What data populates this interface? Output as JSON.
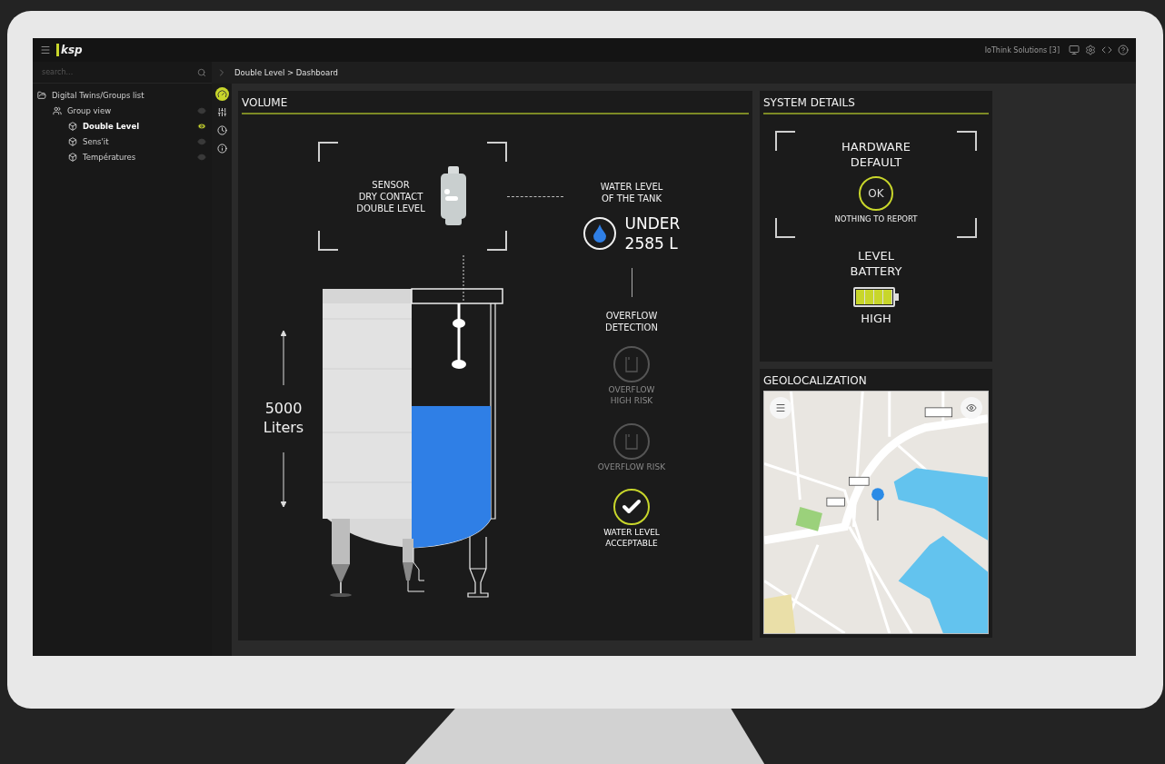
{
  "topbar": {
    "logo": "ksp",
    "account": "IoThink Solutions [3]"
  },
  "sidebar": {
    "search": {
      "placeholder": "search..."
    },
    "tree": [
      {
        "label": "Digital Twins/Groups list",
        "kind": "folder",
        "selected": false,
        "children": [
          {
            "label": "Group view",
            "kind": "group",
            "selected": false,
            "children": [
              {
                "label": "Double Level",
                "kind": "device",
                "selected": true
              },
              {
                "label": "Sens'it",
                "kind": "device",
                "selected": false
              },
              {
                "label": "Températures",
                "kind": "device",
                "selected": false
              }
            ]
          }
        ]
      }
    ]
  },
  "rail": [
    {
      "kind": "dashboard",
      "selected": true
    },
    {
      "kind": "settings",
      "selected": false
    },
    {
      "kind": "history",
      "selected": false
    },
    {
      "kind": "info",
      "selected": false
    }
  ],
  "breadcrumb": "Double Level > Dashboard",
  "volume": {
    "title": "VOLUME",
    "sensor": "SENSOR\nDRY CONTACT\nDOUBLE LEVEL",
    "capacity": "5000\nLiters",
    "tank": {
      "level": 0.58
    },
    "water_level": {
      "title": "WATER LEVEL\nOF THE TANK",
      "reading": "UNDER\n2585 L"
    },
    "overflow": {
      "title": "OVERFLOW\nDETECTION",
      "indicators": [
        {
          "label": "OVERFLOW\nHIGH RISK",
          "kind": "overflow",
          "active": false
        },
        {
          "label": "OVERFLOW RISK",
          "kind": "overflow",
          "active": false
        },
        {
          "label": "WATER LEVEL\nACCEPTABLE",
          "kind": "check",
          "active": true
        }
      ]
    }
  },
  "system": {
    "title": "SYSTEM DETAILS",
    "hardware": {
      "title": "HARDWARE\nDEFAULT",
      "status": "OK",
      "message": "NOTHING TO REPORT"
    },
    "battery": {
      "title": "LEVEL\nBATTERY",
      "level": 1,
      "reading": "HIGH"
    }
  },
  "geo": {
    "title": "GEOLOCALIZATION"
  }
}
